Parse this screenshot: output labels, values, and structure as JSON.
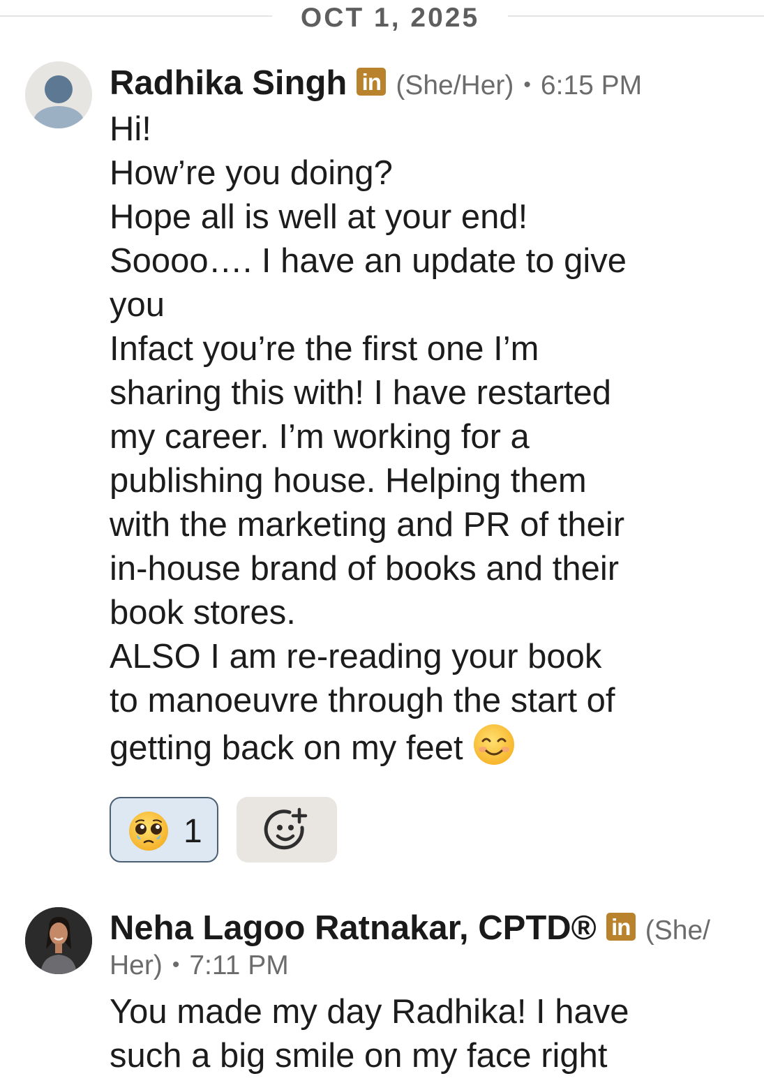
{
  "date_divider": "OCT 1, 2025",
  "messages": [
    {
      "sender": "Radhika Singh",
      "badge": "in",
      "pronouns": "(She/Her)",
      "separator": "•",
      "time": "6:15 PM",
      "lines": [
        "Hi!",
        "How’re you doing?",
        "Hope all is well at your end!",
        "Soooo…. I have an update to give",
        "you",
        "Infact you’re the first one I’m",
        "sharing this with! I have restarted",
        "my career. I’m working for a",
        "publishing house. Helping them",
        "with the marketing and PR of their",
        "in-house brand of books and their",
        "book stores.",
        "ALSO I am re-reading your book",
        "to manoeuvre through the start of",
        "getting back on my feet"
      ],
      "reactions": [
        {
          "emoji_icon": "pleading-face-icon",
          "count": "1"
        }
      ],
      "add_reaction_icon": "add-reaction-icon"
    },
    {
      "sender": "Neha Lagoo Ratnakar, CPTD®",
      "badge": "in",
      "pronouns_part1": "(She/",
      "pronouns_part2": "Her)",
      "separator": "•",
      "time": "7:11 PM",
      "lines": [
        "You made my day Radhika! I have",
        "such a big smile on my face right"
      ]
    }
  ],
  "colors": {
    "linkedin_badge": "#b9822c",
    "reaction_border": "#4a5f72",
    "reaction_bg": "#dde8f2",
    "add_reaction_bg": "#e9e6e2"
  }
}
